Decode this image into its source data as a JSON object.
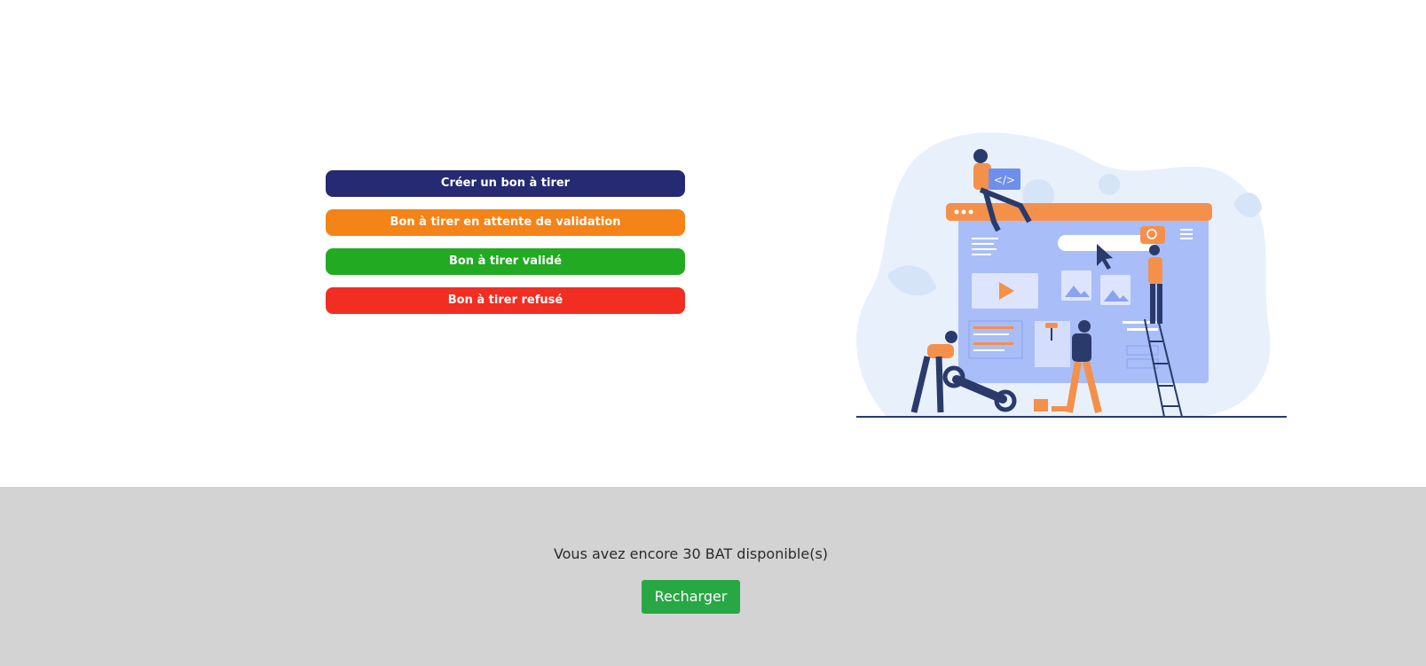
{
  "actions": {
    "create_label": "Créer un bon à tirer",
    "pending_label": "Bon à tirer en attente de validation",
    "validated_label": "Bon à tirer validé",
    "refused_label": "Bon à tirer refusé"
  },
  "colors": {
    "create": "#252a72",
    "pending": "#f48318",
    "validated": "#22aa22",
    "refused": "#f22d22",
    "reload": "#28a745",
    "footer_bg": "#d3d3d3"
  },
  "illustration": {
    "icon": "web-construction-illustration",
    "code_tag": "</>"
  },
  "footer": {
    "balance_text": "Vous avez encore 30 BAT disponible(s)",
    "reload_label": "Recharger"
  }
}
